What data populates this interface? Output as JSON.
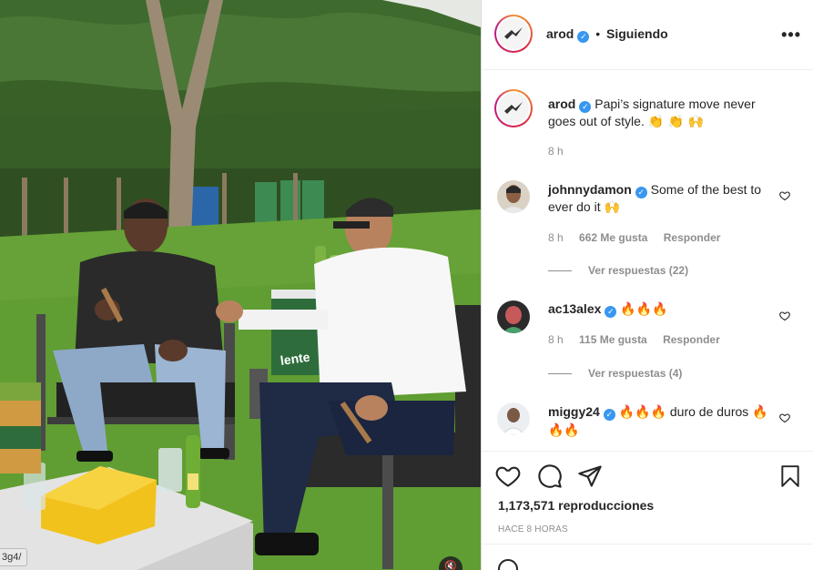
{
  "post": {
    "username": "arod",
    "follow_separator": "•",
    "follow_status": "Siguiendo",
    "more_icon": "•••",
    "caption": {
      "username": "arod",
      "text": "Papi’s signature move never goes out of style.",
      "emojis": "👏 👏 🙌",
      "time": "8 h"
    },
    "comments": [
      {
        "username": "johnnydamon",
        "verified": true,
        "text": "Some of the best to ever do it",
        "emojis": "🙌",
        "time": "8 h",
        "likes": "662 Me gusta",
        "reply": "Responder",
        "view_replies": "Ver respuestas (22)"
      },
      {
        "username": "ac13alex",
        "verified": true,
        "text": "",
        "emojis": "🔥🔥🔥",
        "time": "8 h",
        "likes": "115 Me gusta",
        "reply": "Responder",
        "view_replies": "Ver respuestas (4)"
      },
      {
        "username": "miggy24",
        "verified": true,
        "text": "duro de duros",
        "emojis_before": "🔥🔥🔥",
        "emojis_after": "🔥🔥🔥"
      }
    ],
    "views": "1,173,571 reproducciones",
    "posted": "HACE 8 HORAS"
  },
  "media": {
    "url_fragment": "3g4/",
    "mute_icon": "🔇",
    "bottle_label": "lente"
  },
  "icons": {
    "like": "heart-icon",
    "comment": "comment-icon",
    "share": "share-icon",
    "save": "bookmark-icon",
    "verified": "verified-badge-icon"
  }
}
